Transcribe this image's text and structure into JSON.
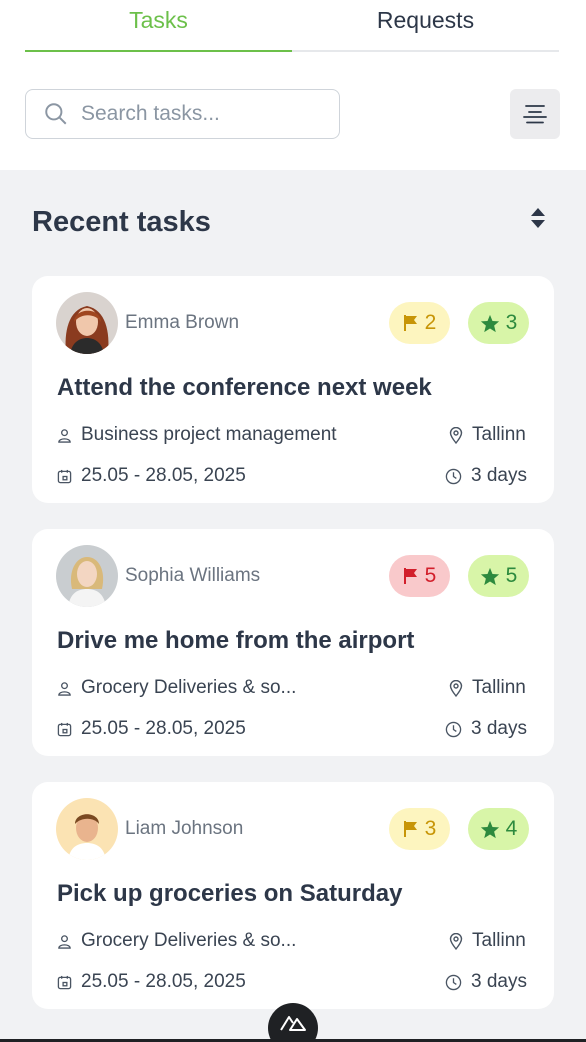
{
  "tabs": [
    {
      "label": "Tasks",
      "active": true
    },
    {
      "label": "Requests",
      "active": false
    }
  ],
  "search": {
    "placeholder": "Search tasks..."
  },
  "section": {
    "title": "Recent tasks"
  },
  "colors": {
    "accent": "#6cc04a",
    "flag_yellow": "#c79507",
    "flag_red": "#d21f2b",
    "star_green": "#2d8a3e"
  },
  "tasks": [
    {
      "user": "Emma Brown",
      "priority": "2",
      "priority_color": "yellow",
      "rating": "3",
      "title": "Attend the conference next week",
      "category": "Business project management",
      "location": "Tallinn",
      "dates": "25.05 - 28.05, 2025",
      "duration": "3 days"
    },
    {
      "user": "Sophia Williams",
      "priority": "5",
      "priority_color": "red",
      "rating": "5",
      "title": "Drive me home from the airport",
      "category": "Grocery Deliveries & so...",
      "location": "Tallinn",
      "dates": "25.05 - 28.05, 2025",
      "duration": "3 days"
    },
    {
      "user": "Liam Johnson",
      "priority": "3",
      "priority_color": "yellow",
      "rating": "4",
      "title": "Pick up groceries on Saturday",
      "category": "Grocery Deliveries & so...",
      "location": "Tallinn",
      "dates": "25.05 - 28.05, 2025",
      "duration": "3 days"
    }
  ]
}
